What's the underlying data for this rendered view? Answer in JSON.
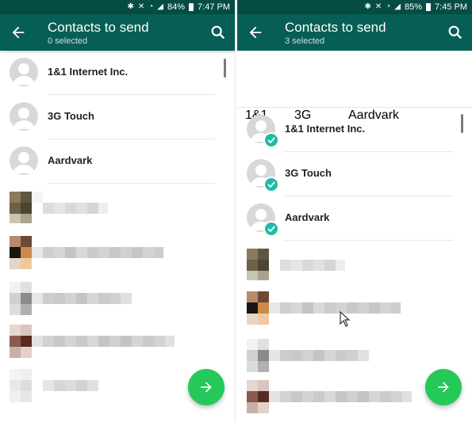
{
  "left": {
    "status": {
      "battery": "84%",
      "time": "7:47 PM"
    },
    "appbar": {
      "title": "Contacts to send",
      "subtitle": "0 selected"
    },
    "contacts": [
      {
        "name": "1&1 Internet Inc."
      },
      {
        "name": "3G Touch"
      },
      {
        "name": "Aardvark"
      }
    ]
  },
  "right": {
    "status": {
      "battery": "85%",
      "time": "7:45 PM"
    },
    "appbar": {
      "title": "Contacts to send",
      "subtitle": "3 selected"
    },
    "selected_chips": [
      {
        "label": "1&1"
      },
      {
        "label": "3G"
      },
      {
        "label": "Aardvark"
      }
    ],
    "contacts": [
      {
        "name": "1&1 Internet Inc.",
        "checked": true
      },
      {
        "name": "3G Touch",
        "checked": true
      },
      {
        "name": "Aardvark",
        "checked": true
      }
    ]
  },
  "icons": {
    "back": "arrow-back-icon",
    "search": "search-icon",
    "send": "arrow-forward-icon",
    "remove": "close-icon",
    "check": "check-icon",
    "avatar": "person-icon"
  },
  "colors": {
    "statusbar": "#054d44",
    "appbar": "#075e54",
    "fab": "#25c95a",
    "check": "#1fbba6",
    "remove_badge": "#8a8a8a"
  }
}
